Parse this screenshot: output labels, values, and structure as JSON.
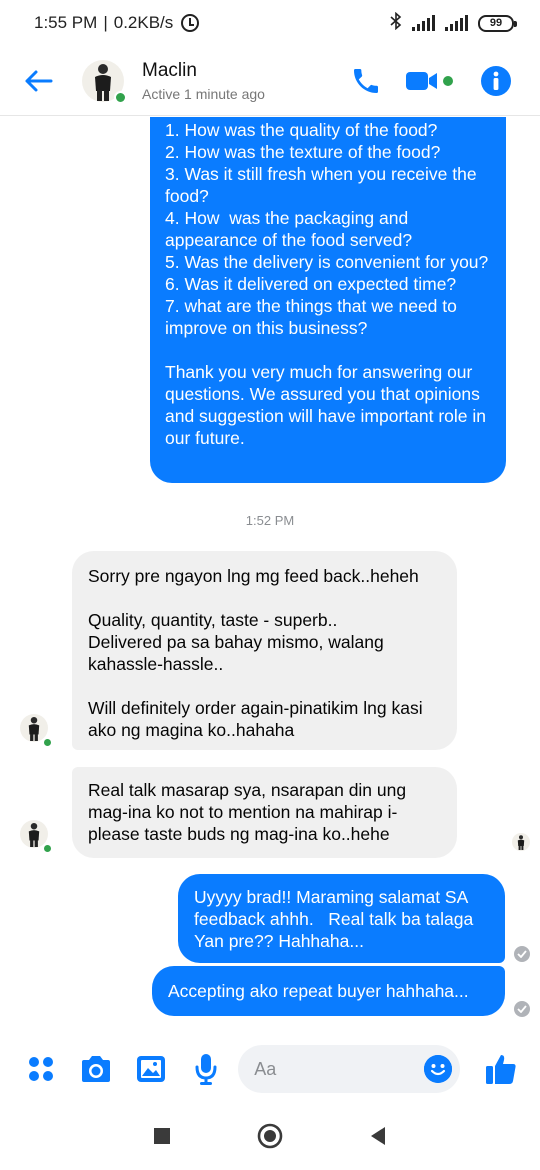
{
  "status_bar": {
    "time": "1:55 PM",
    "speed": "0.2KB/s",
    "battery": "99"
  },
  "header": {
    "contact_name": "Maclin",
    "contact_status": "Active 1 minute ago"
  },
  "messages": [
    {
      "from": "me",
      "text": "1. How was the quality of the food?\n2. How was the texture of the food?\n3. Was it still fresh when you receive the food?\n4. How  was the packaging and appearance of the food served?\n5. Was the delivery is convenient for you?\n6. Was it delivered on expected time?\n7. what are the things that we need to improve on this business?\n\nThank you very much for answering our questions. We assured you that opinions and suggestion will have important role in our future."
    },
    {
      "from": "them",
      "text": "Sorry pre ngayon lng mg feed back..heheh\n\nQuality, quantity, taste - superb..\nDelivered pa sa bahay mismo, walang kahassle-hassle..\n\nWill definitely order again-pinatikim lng kasi ako ng magina ko..hahaha"
    },
    {
      "from": "them",
      "text": "Real talk masarap sya, nsarapan din ung mag-ina ko not to mention na mahirap i-please taste buds ng mag-ina ko..hehe"
    },
    {
      "from": "me",
      "text": "Uyyyy brad!! Maraming salamat SA feedback ahhh.   Real talk ba talaga Yan pre?? Hahhaha..."
    },
    {
      "from": "me",
      "text": "Accepting ako repeat buyer hahhaha..."
    }
  ],
  "timestamp": "1:52 PM",
  "composer": {
    "placeholder": "Aa"
  },
  "colors": {
    "accent": "#0a7cff",
    "online": "#31a24c",
    "incoming_bubble": "#f0f0f0"
  },
  "icons": [
    "back-arrow-icon",
    "phone-icon",
    "video-call-icon",
    "info-icon",
    "menu-dots-icon",
    "camera-icon",
    "gallery-icon",
    "microphone-icon",
    "emoji-icon",
    "thumbs-up-icon",
    "recent-apps-icon",
    "home-icon",
    "back-icon"
  ]
}
